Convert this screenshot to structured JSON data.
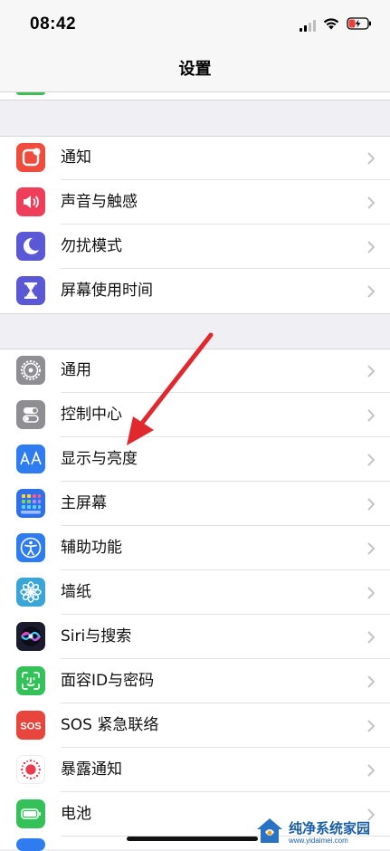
{
  "status_bar": {
    "time": "08:42",
    "icons": [
      "signal-icon",
      "wifi-icon",
      "battery-charging-icon"
    ]
  },
  "header": {
    "title": "设置"
  },
  "groups": [
    {
      "items": [
        {
          "label": "通知",
          "icon": "notifications-icon",
          "color": "#f04b3c"
        },
        {
          "label": "声音与触感",
          "icon": "speaker-icon",
          "color": "#ef3e5a"
        },
        {
          "label": "勿扰模式",
          "icon": "moon-icon",
          "color": "#5b58d6"
        },
        {
          "label": "屏幕使用时间",
          "icon": "hourglass-icon",
          "color": "#5b58d6"
        }
      ]
    },
    {
      "items": [
        {
          "label": "通用",
          "icon": "gear-icon",
          "color": "#8e8e93"
        },
        {
          "label": "控制中心",
          "icon": "toggles-icon",
          "color": "#8e8e93"
        },
        {
          "label": "显示与亮度",
          "icon": "text-size-icon",
          "color": "#2f7bf0"
        },
        {
          "label": "主屏幕",
          "icon": "home-screen-grid-icon",
          "color": "#2f6fe8"
        },
        {
          "label": "辅助功能",
          "icon": "accessibility-icon",
          "color": "#2f7bf0"
        },
        {
          "label": "墙纸",
          "icon": "flower-icon",
          "color": "#3aa6d8"
        },
        {
          "label": "Siri与搜索",
          "icon": "siri-icon",
          "color": "#1b1b2e"
        },
        {
          "label": "面容ID与密码",
          "icon": "face-id-icon",
          "color": "#35c15a"
        },
        {
          "label": "SOS 紧急联络",
          "icon": "sos-icon",
          "color": "#e8453c"
        },
        {
          "label": "暴露通知",
          "icon": "exposure-icon",
          "color": "#ffffff"
        },
        {
          "label": "电池",
          "icon": "battery-icon",
          "color": "#35c15a"
        }
      ]
    }
  ],
  "annotation": {
    "arrow_color": "#e0282e"
  },
  "watermark": {
    "main": "纯净系统家园",
    "sub": "www.yidaimei.com"
  }
}
